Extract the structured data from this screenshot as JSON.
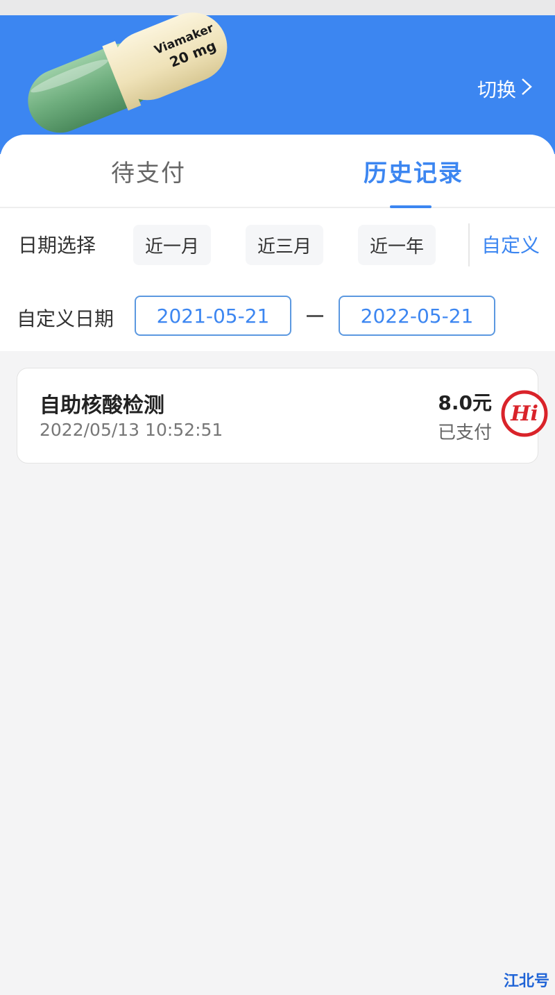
{
  "header": {
    "switch_label": "切换",
    "switch_chevron": ">",
    "pill_text_line1": "Viamaker",
    "pill_text_line2": "20 mg"
  },
  "tabs": {
    "pending": "待支付",
    "history": "历史记录"
  },
  "date_filter": {
    "label": "日期选择",
    "options": [
      "近一月",
      "近三月",
      "近一年"
    ],
    "custom": "自定义"
  },
  "custom_date": {
    "label": "自定义日期",
    "start": "2021-05-21",
    "end": "2022-05-21"
  },
  "records": [
    {
      "title": "自助核酸检测",
      "time": "2022/05/13 10:52:51",
      "amount": "8.0元",
      "status": "已支付"
    }
  ],
  "badge_text": "Hi",
  "watermark": "江北号",
  "colors": {
    "primary": "#3c86f1",
    "background": "#f4f4f5",
    "badge_red": "#d9232a"
  }
}
